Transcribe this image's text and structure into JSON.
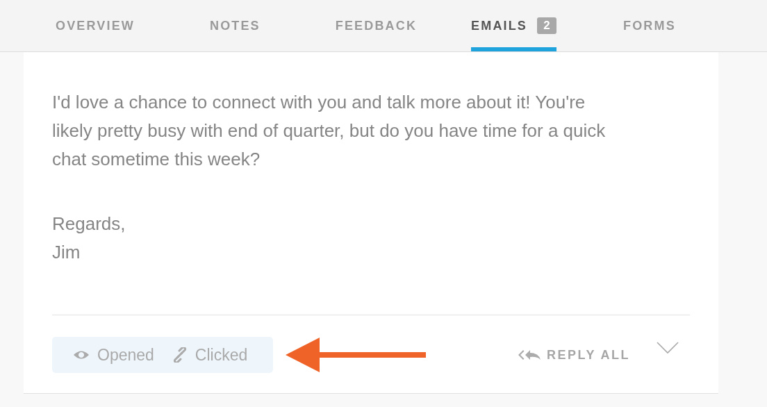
{
  "tabs": [
    {
      "label": "OVERVIEW",
      "selected": false
    },
    {
      "label": "NOTES",
      "selected": false
    },
    {
      "label": "FEEDBACK",
      "selected": false
    },
    {
      "label": "EMAILS",
      "selected": true,
      "count": "2"
    },
    {
      "label": "FORMS",
      "selected": false
    }
  ],
  "email": {
    "paragraphs": [
      "I'd love a chance to connect with you and talk more about it! You're likely pretty busy with end of quarter, but do you have time for a quick chat sometime this week?",
      "Regards,\nJim"
    ],
    "tracking": [
      {
        "kind": "opened",
        "label": "Opened"
      },
      {
        "kind": "clicked",
        "label": "Clicked"
      }
    ],
    "reply_all": "REPLY ALL"
  }
}
